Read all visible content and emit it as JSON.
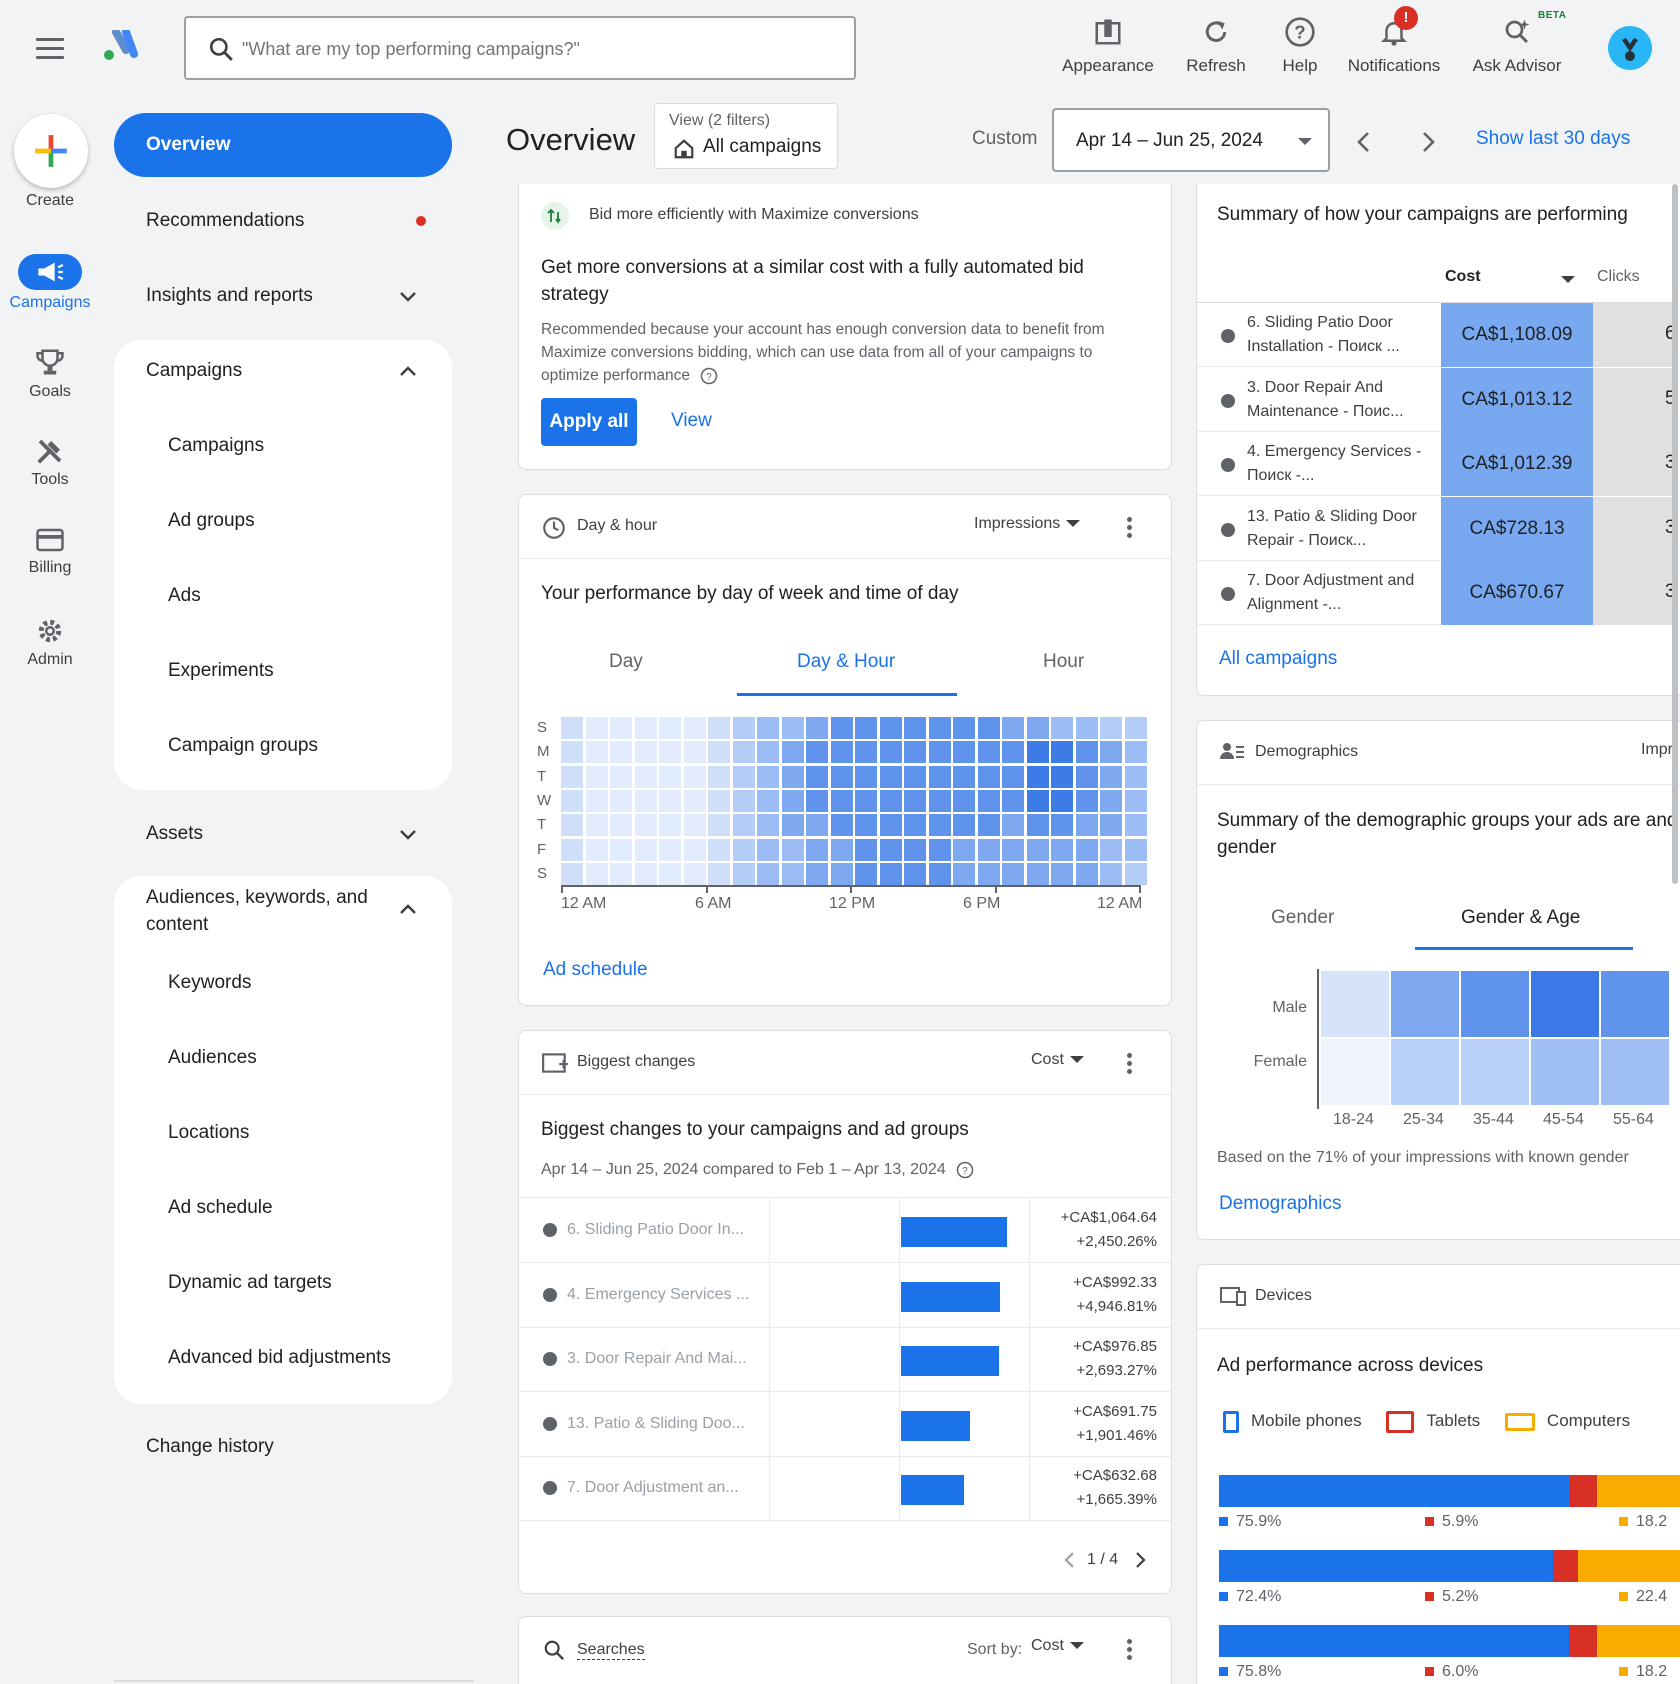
{
  "search": {
    "placeholder": "\"What are my top performing campaigns?\""
  },
  "topbar": {
    "appearance": "Appearance",
    "refresh": "Refresh",
    "help": "Help",
    "notifications": "Notifications",
    "notifications_badge": "!",
    "ask_advisor": "Ask Advisor",
    "beta": "BETA"
  },
  "rail": {
    "create": "Create",
    "campaigns": "Campaigns",
    "goals": "Goals",
    "tools": "Tools",
    "billing": "Billing",
    "admin": "Admin"
  },
  "nav": {
    "overview": "Overview",
    "recommendations": "Recommendations",
    "insights": "Insights and reports",
    "campaigns_group": "Campaigns",
    "campaigns": "Campaigns",
    "ad_groups": "Ad groups",
    "ads": "Ads",
    "experiments": "Experiments",
    "campaign_groups": "Campaign groups",
    "assets": "Assets",
    "audiences_group": "Audiences, keywords, and content",
    "keywords": "Keywords",
    "audiences": "Audiences",
    "locations": "Locations",
    "ad_schedule": "Ad schedule",
    "dynamic_ad_targets": "Dynamic ad targets",
    "advanced_bid": "Advanced bid adjustments",
    "change_history": "Change history"
  },
  "header": {
    "title": "Overview",
    "view_label": "View (2 filters)",
    "view_value": "All campaigns",
    "custom": "Custom",
    "date_range": "Apr 14 – Jun 25, 2024",
    "show_last": "Show last 30 days"
  },
  "rec": {
    "tag": "Bid more efficiently with Maximize conversions",
    "title": "Get more conversions at a similar cost with a fully automated bid strategy",
    "body": "Recommended because your account has enough conversion data to benefit from Maximize conversions bidding, which can use data from all of your campaigns to optimize performance",
    "apply": "Apply all",
    "view": "View"
  },
  "dayhour": {
    "title": "Day & hour",
    "metric": "Impressions",
    "subtitle": "Your performance by day of week and time of day",
    "tabs": [
      "Day",
      "Day & Hour",
      "Hour"
    ],
    "days": [
      "S",
      "M",
      "T",
      "W",
      "T",
      "F",
      "S"
    ],
    "x_ticks": [
      "12 AM",
      "6 AM",
      "12 PM",
      "6 PM",
      "12 AM"
    ],
    "link": "Ad schedule",
    "grid": [
      [
        2,
        1,
        1,
        1,
        1,
        1,
        2,
        3,
        4,
        4,
        5,
        6,
        6,
        6,
        6,
        6,
        6,
        6,
        5,
        5,
        4,
        4,
        3,
        3
      ],
      [
        2,
        1,
        1,
        1,
        1,
        1,
        2,
        3,
        4,
        5,
        6,
        6,
        6,
        6,
        6,
        6,
        6,
        6,
        6,
        7,
        7,
        6,
        5,
        4
      ],
      [
        2,
        1,
        1,
        1,
        1,
        1,
        2,
        3,
        4,
        5,
        6,
        6,
        6,
        6,
        6,
        6,
        6,
        6,
        6,
        7,
        7,
        6,
        5,
        4
      ],
      [
        2,
        1,
        1,
        1,
        1,
        1,
        2,
        3,
        4,
        5,
        6,
        6,
        6,
        6,
        6,
        6,
        6,
        6,
        6,
        7,
        7,
        6,
        5,
        4
      ],
      [
        2,
        1,
        1,
        1,
        1,
        1,
        2,
        3,
        4,
        5,
        5,
        6,
        6,
        6,
        6,
        6,
        6,
        6,
        5,
        6,
        6,
        5,
        5,
        4
      ],
      [
        2,
        1,
        1,
        1,
        1,
        1,
        2,
        3,
        4,
        4,
        5,
        5,
        6,
        6,
        6,
        6,
        5,
        5,
        5,
        5,
        5,
        5,
        4,
        4
      ],
      [
        2,
        1,
        1,
        1,
        1,
        1,
        2,
        3,
        4,
        4,
        5,
        5,
        6,
        6,
        6,
        6,
        5,
        5,
        5,
        5,
        5,
        5,
        4,
        3
      ]
    ]
  },
  "changes": {
    "title": "Biggest changes",
    "metric": "Cost",
    "subtitle": "Biggest changes to your campaigns and ad groups",
    "period": "Apr 14 – Jun 25, 2024 compared to Feb 1 – Apr 13, 2024",
    "rows": [
      {
        "name": "6. Sliding Patio Door In...",
        "delta": "+CA$1,064.64",
        "pct": "+2,450.26%",
        "frac": 1.0
      },
      {
        "name": "4. Emergency Services ...",
        "delta": "+CA$992.33",
        "pct": "+4,946.81%",
        "frac": 0.93
      },
      {
        "name": "3. Door Repair And Mai...",
        "delta": "+CA$976.85",
        "pct": "+2,693.27%",
        "frac": 0.92
      },
      {
        "name": "13. Patio & Sliding Doo...",
        "delta": "+CA$691.75",
        "pct": "+1,901.46%",
        "frac": 0.65
      },
      {
        "name": "7. Door Adjustment an...",
        "delta": "+CA$632.68",
        "pct": "+1,665.39%",
        "frac": 0.59
      }
    ],
    "pager": "1 / 4"
  },
  "searches": {
    "title": "Searches",
    "sortby": "Sort by:",
    "metric": "Cost"
  },
  "summary": {
    "title": "Summary of how your campaigns are performing",
    "col_cost": "Cost",
    "col_clicks": "Clicks",
    "rows": [
      {
        "name": "6. Sliding Patio Door Installation - Поиск ...",
        "cost": "CA$1,108.09"
      },
      {
        "name": "3. Door Repair And Maintenance - Поис...",
        "cost": "CA$1,013.12"
      },
      {
        "name": "4. Emergency Services - Поиск -...",
        "cost": "CA$1,012.39"
      },
      {
        "name": "13. Patio & Sliding Door Repair - Поиск...",
        "cost": "CA$728.13"
      },
      {
        "name": "7. Door Adjustment and Alignment -...",
        "cost": "CA$670.67"
      }
    ],
    "clicks_partial": [
      "6",
      "5",
      "3",
      "3",
      "3"
    ],
    "link": "All campaigns"
  },
  "demo": {
    "title": "Demographics",
    "metric_partial": "Impr",
    "subtitle": "Summary of the demographic groups your ads are and gender",
    "tabs": [
      "Gender",
      "Gender & Age"
    ],
    "rows": [
      "Male",
      "Female"
    ],
    "cols": [
      "18-24",
      "25-34",
      "35-44",
      "45-54",
      "55-64"
    ],
    "grid": [
      [
        1,
        4,
        5,
        6,
        5
      ],
      [
        0,
        2,
        2,
        3,
        3
      ]
    ],
    "note": "Based on the 71% of your impressions with known gender",
    "link": "Demographics"
  },
  "devices": {
    "title": "Devices",
    "subtitle": "Ad performance across devices",
    "legend": [
      "Mobile phones",
      "Tablets",
      "Computers"
    ],
    "colors": {
      "mobile": "#1a73e8",
      "tablet": "#d93025",
      "computer": "#f9ab00"
    },
    "rows": [
      {
        "mobile": 75.9,
        "tablet": 5.9,
        "computer": 18.2,
        "m": "75.9%",
        "t": "5.9%",
        "c": "18.2"
      },
      {
        "mobile": 72.4,
        "tablet": 5.2,
        "computer": 22.4,
        "m": "72.4%",
        "t": "5.2%",
        "c": "22.4"
      },
      {
        "mobile": 75.8,
        "tablet": 6.0,
        "computer": 18.2,
        "m": "75.8%",
        "t": "6.0%",
        "c": "18.2"
      }
    ]
  }
}
